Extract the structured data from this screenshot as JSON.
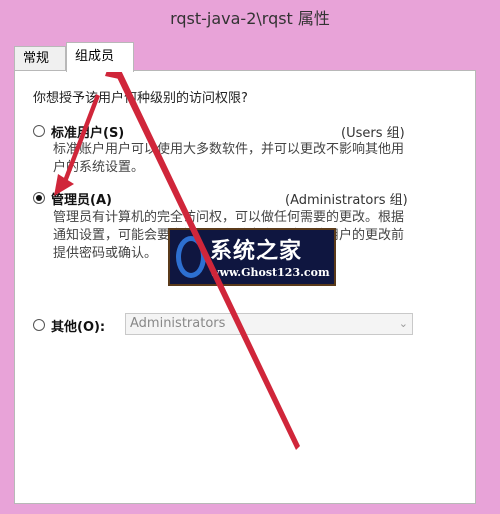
{
  "window": {
    "title": "rqst-java-2\\rqst 属性"
  },
  "tabs": [
    {
      "label": "常规",
      "selected": false
    },
    {
      "label": "组成员",
      "selected": true
    }
  ],
  "question": "你想授予该用户何种级别的访问权限?",
  "options": [
    {
      "label": "标准用户(S)",
      "group": "(Users 组)",
      "description": [
        "标准账户用户可以使用大多数软件，并可以更改不影响其他用",
        "户的系统设置。"
      ],
      "checked": false
    },
    {
      "label": "管理员(A)",
      "group": "(Administrators 组)",
      "description": [
        "管理员有计算机的完全访问权，可以做任何需要的更改。根据",
        "通知设置，可能会要求管理员在做出会影响其他用户的更改前",
        "提供密码或确认。"
      ],
      "checked": true
    },
    {
      "label": "其他(O):",
      "checked": false
    }
  ],
  "other_select": {
    "value": "Administrators"
  },
  "watermark": {
    "title": "系统之家",
    "url": "www.Ghost123.com"
  },
  "colors": {
    "window_frame": "#e8a3d8",
    "annotation_arrow": "#d0263a",
    "watermark_bg": "#0f1640"
  }
}
